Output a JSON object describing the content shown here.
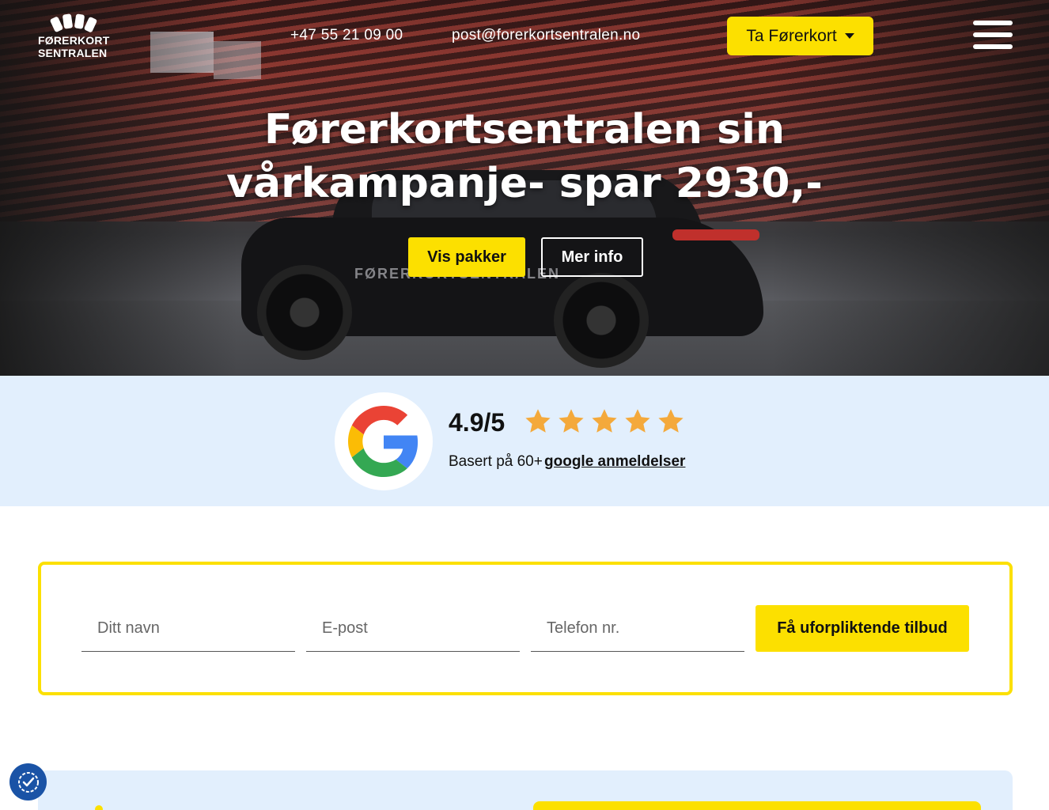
{
  "header": {
    "logo_line1": "FØRERKORT",
    "logo_line2": "SENTRALEN",
    "phone": "+47 55 21 09 00",
    "email": "post@forerkortsentralen.no",
    "cta_label": "Ta Førerkort",
    "cta_icon": "caret-down-icon",
    "menu_icon": "hamburger-menu-icon"
  },
  "hero": {
    "title_line1": "Førerkortsentralen sin",
    "title_line2": "vårkampanje- spar 2930,-",
    "primary_button": "Vis pakker",
    "secondary_button": "Mer info",
    "car_text": "FØRERKORTSENTRALEN"
  },
  "rating": {
    "score": "4.9/5",
    "stars": 5,
    "based_on": "Basert på 60+",
    "link_text": "google anmeldelser",
    "star_color": "#f4a93b"
  },
  "form": {
    "name_placeholder": "Ditt navn",
    "email_placeholder": "E-post",
    "phone_placeholder": "Telefon nr.",
    "submit_label": "Få uforpliktende tilbud"
  },
  "colors": {
    "accent": "#fce000",
    "band": "#e2effd",
    "cookie": "#1a53a6"
  },
  "cookie_icon": "cookie-consent-icon"
}
